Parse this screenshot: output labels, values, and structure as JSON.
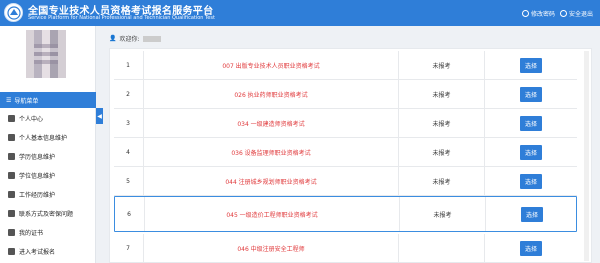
{
  "header": {
    "title_cn": "全国专业技术人员资格考试报名服务平台",
    "title_en": "Service Platform for National Professional and Technician Qualification Test",
    "change_password": "修改密码",
    "logout": "安全退出"
  },
  "sidebar": {
    "nav_title": "导航菜单",
    "items": [
      {
        "label": "个人中心",
        "icon": "home-icon"
      },
      {
        "label": "个人基本信息维护",
        "icon": "user-icon"
      },
      {
        "label": "学历信息维护",
        "icon": "education-icon"
      },
      {
        "label": "学位信息维护",
        "icon": "degree-icon"
      },
      {
        "label": "工作经历维护",
        "icon": "briefcase-icon"
      },
      {
        "label": "联系方式及密保问题",
        "icon": "phone-icon"
      },
      {
        "label": "我的证书",
        "icon": "certificate-icon"
      },
      {
        "label": "进入考试报名",
        "icon": "enter-icon"
      }
    ]
  },
  "main": {
    "welcome_label": "欢迎你:",
    "select_label": "选择",
    "rows": [
      {
        "no": "1",
        "name": "007 出版专业技术人员职业资格考试",
        "status": "未报考"
      },
      {
        "no": "2",
        "name": "026 执业药师职业资格考试",
        "status": "未报考"
      },
      {
        "no": "3",
        "name": "034 一级建造师资格考试",
        "status": "未报考"
      },
      {
        "no": "4",
        "name": "036 设备监理师职业资格考试",
        "status": "未报考"
      },
      {
        "no": "5",
        "name": "044 注册城乡规划师职业资格考试",
        "status": "未报考"
      },
      {
        "no": "6",
        "name": "045 一级造价工程师职业资格考试",
        "status": "未报考"
      },
      {
        "no": "7",
        "name": "046 中级注册安全工程师",
        "status": ""
      }
    ]
  },
  "colors": {
    "primary": "#2f7ed8",
    "exam_name": "#e0383a"
  }
}
